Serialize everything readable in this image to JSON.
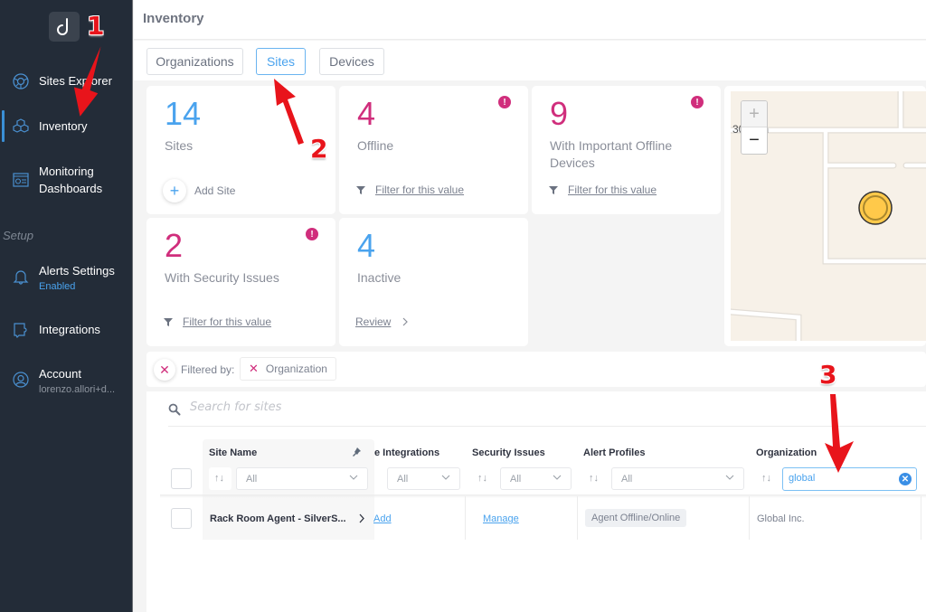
{
  "sidebar": {
    "logo_glyph": "d",
    "items": [
      {
        "label": "Sites Explorer",
        "icon": "globe-icon"
      },
      {
        "label": "Inventory",
        "icon": "cubes-icon",
        "active": true
      },
      {
        "label": "Monitoring",
        "label2": "Dashboards",
        "icon": "dashboard-icon"
      }
    ],
    "section_label": "Setup",
    "setup_items": [
      {
        "label": "Alerts Settings",
        "sub": "Enabled",
        "icon": "bell-icon"
      },
      {
        "label": "Integrations",
        "icon": "puzzle-icon"
      },
      {
        "label": "Account",
        "sub": "lorenzo.allori+d...",
        "icon": "user-circle-icon"
      }
    ]
  },
  "header": {
    "title": "Inventory"
  },
  "tabs": [
    {
      "label": "Organizations",
      "active": false
    },
    {
      "label": "Sites",
      "active": true
    },
    {
      "label": "Devices",
      "active": false
    }
  ],
  "cards": [
    {
      "value": "14",
      "caption": "Sites",
      "action": "Add Site",
      "color": "#4aa3ee",
      "alert": false
    },
    {
      "value": "4",
      "caption": "Offline",
      "action": "Filter for this value",
      "color": "#d02e7c",
      "alert": true
    },
    {
      "value": "9",
      "caption": "With Important Offline Devices",
      "action": "Filter for this value",
      "color": "#d02e7c",
      "alert": true
    },
    {
      "value": "2",
      "caption": "With Security Issues",
      "action": "Filter for this value",
      "color": "#d02e7c",
      "alert": true
    },
    {
      "value": "4",
      "caption": "Inactive",
      "action": "Review",
      "color": "#4aa3ee",
      "alert": false
    }
  ],
  "alert_glyph": "!",
  "map": {
    "zoom_in": "+",
    "zoom_out": "−",
    "street_label": "30  outh",
    "marker_color": "#ffc94a"
  },
  "filters": {
    "label": "Filtered by:",
    "chips": [
      {
        "label": "Organization"
      }
    ],
    "remove_glyph": "✕"
  },
  "search": {
    "placeholder": "Search for sites",
    "value": ""
  },
  "table": {
    "columns": [
      {
        "header": "Site Name",
        "filter": "All",
        "pinned": true
      },
      {
        "header": "e Integrations",
        "filter": "All"
      },
      {
        "header": "Security Issues",
        "filter": "All"
      },
      {
        "header": "Alert Profiles",
        "filter": "All"
      },
      {
        "header": "Organization",
        "filter": "global"
      }
    ],
    "sort_glyph": "↑↓",
    "rows": [
      {
        "site_name": "Rack Room Agent - SilverS...",
        "integrations": "Add",
        "security": "Manage",
        "alert_profile": "Agent Offline/Online",
        "organization": "Global Inc."
      }
    ]
  },
  "annotations": [
    "1",
    "2",
    "3"
  ],
  "colors": {
    "accent_blue": "#4aa3ee",
    "alert_pink": "#d02e7c",
    "sidebar_bg": "#232c38",
    "annotation_red": "#e8141b"
  }
}
